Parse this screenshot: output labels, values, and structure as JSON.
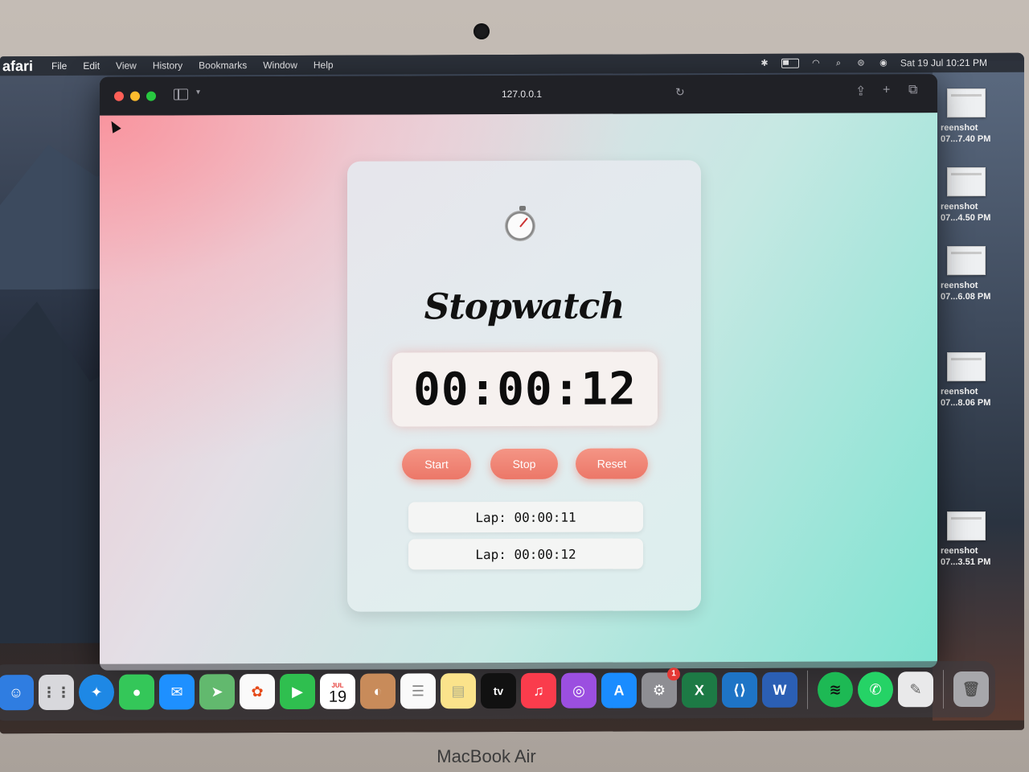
{
  "menubar": {
    "app": "afari",
    "items": [
      "File",
      "Edit",
      "View",
      "History",
      "Bookmarks",
      "Window",
      "Help"
    ],
    "datetime": "Sat 19 Jul  10:21 PM"
  },
  "browser": {
    "url": "127.0.0.1"
  },
  "stopwatch": {
    "title": "Stopwatch",
    "time": "00:00:12",
    "buttons": {
      "start": "Start",
      "stop": "Stop",
      "reset": "Reset"
    },
    "laps": [
      "Lap: 00:00:11",
      "Lap: 00:00:12"
    ]
  },
  "desktop_files": [
    {
      "line1": "reenshot",
      "line2": "07...7.40 PM"
    },
    {
      "line1": "reenshot",
      "line2": "07...4.50 PM"
    },
    {
      "line1": "reenshot",
      "line2": "07...6.08 PM"
    },
    {
      "line1": "reenshot",
      "line2": "07...8.06 PM"
    },
    {
      "line1": "reenshot",
      "line2": "07...3.51 PM"
    }
  ],
  "dock": {
    "calendar_month": "JUL",
    "calendar_day": "19",
    "tv_label": "tv",
    "settings_badge": "1"
  },
  "bezel_label": "MacBook Air",
  "colors": {
    "accent": "#ec7768",
    "title": "#111111"
  }
}
